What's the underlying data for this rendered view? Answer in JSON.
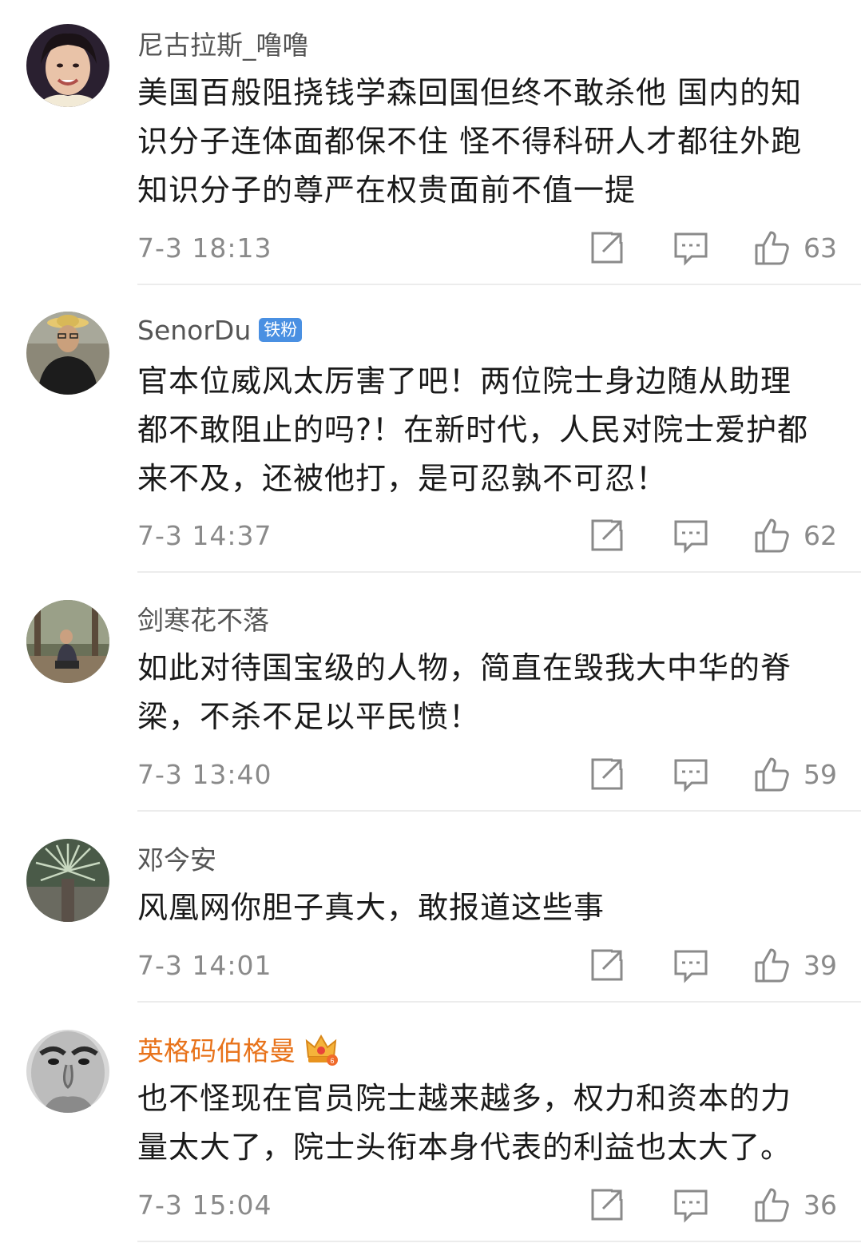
{
  "comments": [
    {
      "username": "尼古拉斯_噜噜",
      "lines": [
        "美国百般阻挠钱学森回国但终不敢杀他 国内的知",
        "识分子连体面都保不住 怪不得科研人才都往外跑",
        "知识分子的尊严在权贵面前不值一提"
      ],
      "timestamp": "7-3 18:13",
      "likes": "63"
    },
    {
      "username": "SenorDu",
      "badge": "铁粉",
      "lines": [
        "官本位威风太厉害了吧！两位院士身边随从助理",
        "都不敢阻止的吗?！在新时代，人民对院士爱护都",
        "来不及，还被他打，是可忍孰不可忍！"
      ],
      "timestamp": "7-3 14:37",
      "likes": "62"
    },
    {
      "username": "剑寒花不落",
      "lines": [
        "如此对待国宝级的人物，简直在毁我大中华的脊",
        "梁，不杀不足以平民愤！"
      ],
      "timestamp": "7-3 13:40",
      "likes": "59"
    },
    {
      "username": "邓今安",
      "lines": [
        "风凰网你胆子真大，敢报道这些事"
      ],
      "timestamp": "7-3 14:01",
      "likes": "39"
    },
    {
      "username": "英格码伯格曼",
      "lines": [
        "也不怪现在官员院士越来越多，权力和资本的力",
        "量太大了，院士头衔本身代表的利益也太大了。"
      ],
      "timestamp": "7-3 15:04",
      "likes": "36"
    }
  ],
  "icons": {
    "repost": "repost-icon",
    "reply": "reply-icon",
    "like": "thumbs-up-icon",
    "crown": "crown-icon"
  },
  "colors": {
    "vip_name": "#e8731b",
    "badge": "#4a90e2",
    "meta": "#8a8a8a"
  }
}
